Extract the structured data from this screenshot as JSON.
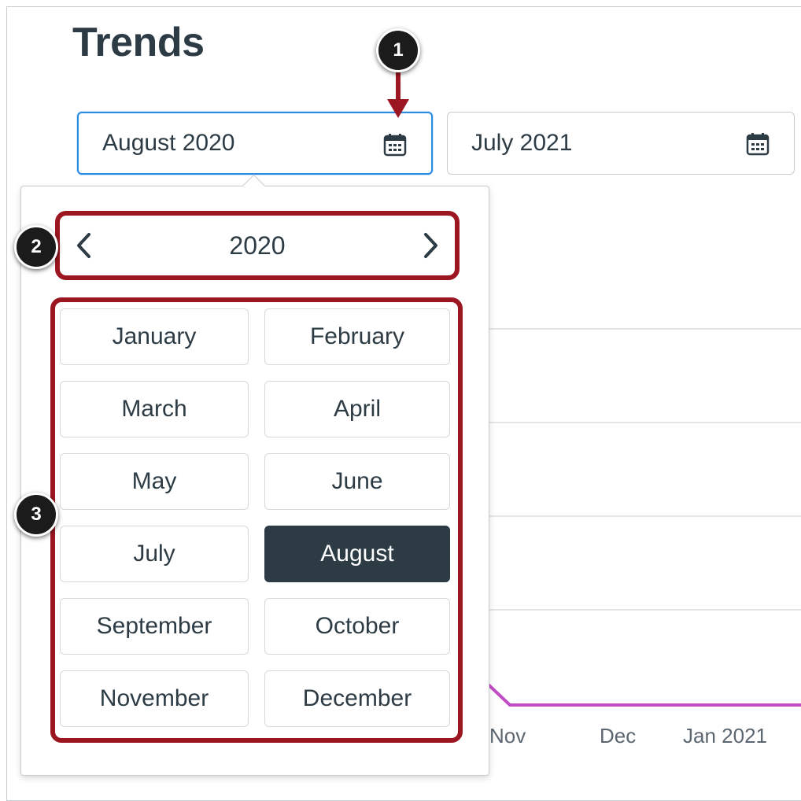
{
  "page": {
    "title": "Trends"
  },
  "start_date": {
    "value": "August 2020",
    "icon": "calendar-icon"
  },
  "end_date": {
    "value": "July 2021",
    "icon": "calendar-icon"
  },
  "picker": {
    "year": "2020",
    "prev_icon": "chevron-left-icon",
    "next_icon": "chevron-right-icon",
    "months": [
      "January",
      "February",
      "March",
      "April",
      "May",
      "June",
      "July",
      "August",
      "September",
      "October",
      "November",
      "December"
    ],
    "selected_month": "August"
  },
  "callouts": [
    "1",
    "2",
    "3"
  ],
  "chart": {
    "x_ticks": [
      "Nov",
      "Dec",
      "Jan 2021"
    ],
    "line_color": "#c04bc4"
  },
  "colors": {
    "accent": "#2b8ae2",
    "callout_border": "#9b1620",
    "selected": "#2d3b45"
  }
}
